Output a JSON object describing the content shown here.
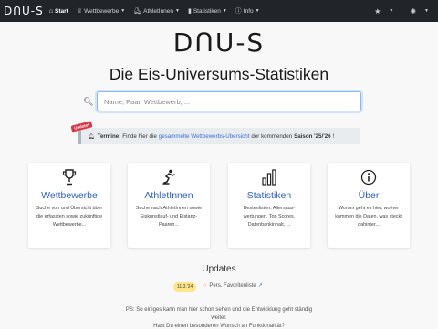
{
  "navbar": {
    "brand": "DꓵU-S",
    "items": [
      {
        "label": "Start",
        "icon": "home-icon",
        "glyph": "⌂",
        "active": true
      },
      {
        "label": "Wettbewerbe",
        "icon": "trophy-icon",
        "glyph": "♕",
        "dropdown": true
      },
      {
        "label": "AthletInnen",
        "icon": "skater-icon",
        "glyph": "⛸",
        "dropdown": true
      },
      {
        "label": "Statistiken",
        "icon": "bar-chart-icon",
        "glyph": "▮",
        "dropdown": true
      },
      {
        "label": "Info",
        "icon": "info-icon",
        "glyph": "ⓘ",
        "dropdown": true
      }
    ],
    "favorites_icon": "star-icon",
    "theme_icon": "sun-icon"
  },
  "header": {
    "logo": "DꓵU-S",
    "title": "Die Eis-Universums-Statistiken"
  },
  "search": {
    "placeholder": "Name, Paar, Wettbewerb, ...",
    "value": ""
  },
  "notice": {
    "badge": "Update!",
    "label": "Termine:",
    "text_before": "Finde hier die",
    "link": "gesammelte Wettbewerbs-Übersicht",
    "text_middle": "der kommenden",
    "season": "Saison '25/'26",
    "text_after": "!"
  },
  "cards": [
    {
      "title": "Wettbewerbe",
      "icon": "trophy-icon",
      "description": "Suche von und Übersicht über die erfassten sowie zukünftige Wettbewerbe..."
    },
    {
      "title": "AthletInnen",
      "icon": "skater-icon",
      "description": "Suche nach AthletInnen sowie Eiskunstlauf- und Eistanz-Paaren..."
    },
    {
      "title": "Statistiken",
      "icon": "bar-chart-icon",
      "description": "Bestenlisten, Altersaus-wertungen, Top Scores, Datenbankinhalt, ..."
    },
    {
      "title": "Über",
      "icon": "info-icon",
      "description": "Worum geht es hier, wo-her kommen die Daten, was steckt dahinter..."
    }
  ],
  "updates": {
    "title": "Updates",
    "date": "11.3.'24",
    "favorite_label": "Pers. Favoritenliste",
    "ps_line1": "PS: So einiges kann man hier schon sehen und die Entwicklung geht ständig",
    "ps_line2": "weiter.",
    "ps_line3": "Hast Du einen besonderen Wunsch an Funktionalität?"
  },
  "colors": {
    "navbar_bg": "#212529",
    "accent": "#2f5fc4",
    "update_badge": "#dc3545",
    "date_badge": "#fde68a"
  }
}
